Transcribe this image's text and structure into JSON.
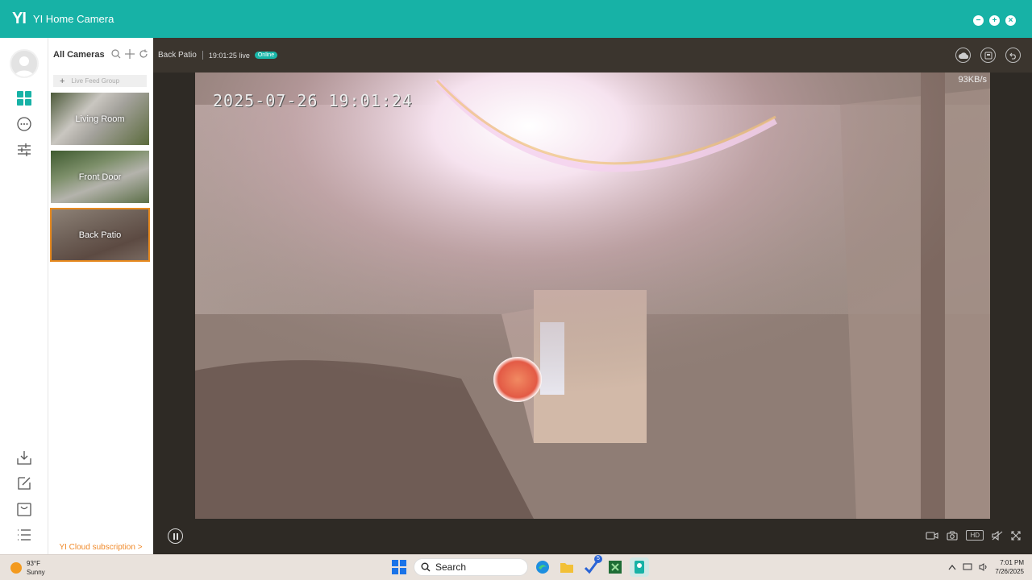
{
  "app": {
    "logo_mark": "YI",
    "title": "YI Home Camera"
  },
  "window_controls": {
    "minimize": "−",
    "maximize": "+",
    "close": "×"
  },
  "list": {
    "title": "All Cameras",
    "group_button": "Live Feed Group",
    "cameras": [
      {
        "label": "Living Room",
        "selected": false
      },
      {
        "label": "Front Door",
        "selected": false
      },
      {
        "label": "Back Patio",
        "selected": true
      }
    ],
    "cloud_link": "YI Cloud subscription >"
  },
  "player": {
    "camera_name": "Back Patio",
    "live_time": "19:01:25 live",
    "status_badge": "Online",
    "osd_timestamp": "2025-07-26 19:01:24",
    "bitrate": "93KB/s",
    "quality": "HD"
  },
  "taskbar": {
    "weather_temp": "93°F",
    "weather_desc": "Sunny",
    "search_label": "Search",
    "badge_count": "5",
    "time": "7:01 PM",
    "date": "7/26/2025"
  },
  "colors": {
    "accent": "#17b2a6",
    "selected_outline": "#e78a1f",
    "cloud_link": "#f08a2a"
  }
}
